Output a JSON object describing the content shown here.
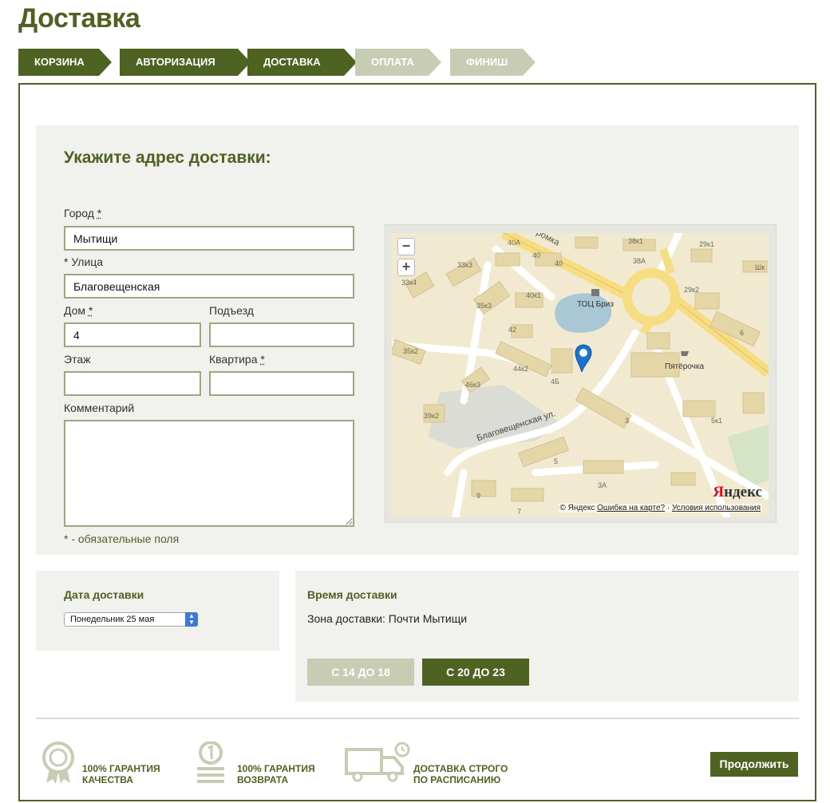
{
  "page": {
    "title": "Доставка"
  },
  "steps": [
    {
      "label": "Корзина",
      "state": "done"
    },
    {
      "label": "Авторизация",
      "state": "done"
    },
    {
      "label": "Доставка",
      "state": "active"
    },
    {
      "label": "Оплата",
      "state": "pending"
    },
    {
      "label": "Финиш",
      "state": "pending"
    }
  ],
  "address": {
    "title": "Укажите адрес доставки:",
    "city_label": "Город",
    "city_value": "Мытищи",
    "street_label": "Улица",
    "street_value": "Благовещенская",
    "house_label": "Дом",
    "house_value": "4",
    "entrance_label": "Подъезд",
    "entrance_value": "",
    "floor_label": "Этаж",
    "floor_value": "",
    "apartment_label": "Квартира",
    "apartment_value": "",
    "comment_label": "Комментарий",
    "comment_value": "",
    "required_star": "*",
    "required_note": "* - обязательные поля"
  },
  "map": {
    "copyright": "© Яндекс",
    "error_link": "Ошибка на карте?",
    "separator": "·",
    "terms_link": "Условия использования",
    "logo_first": "Я",
    "logo_rest": "ндекс",
    "zoom_out": "−",
    "zoom_in": "+",
    "street_name": "Благовещенская ул.",
    "road_name": "ромка",
    "poi_mall": "ТОЦ Бриз",
    "poi_shop": "Пятёрочка",
    "house_numbers": [
      "40А",
      "40",
      "40",
      "38к1",
      "38А",
      "29к1",
      "Шк",
      "33к3",
      "33к4",
      "35к3",
      "40к1",
      "42",
      "29к2",
      "6",
      "35к2",
      "44к2",
      "4Б",
      "46к3",
      "39к2",
      "3",
      "5к1",
      "5",
      "3А",
      "9",
      "7"
    ]
  },
  "delivery_date": {
    "title": "Дата доставки",
    "selected": "Понедельник 25 мая"
  },
  "delivery_time": {
    "title": "Время доставки",
    "zone_text": "Зона доставки: Почти Мытищи",
    "slots": [
      {
        "label": "С 14 ДО 18",
        "selected": false
      },
      {
        "label": "С 20 ДО 23",
        "selected": true
      }
    ]
  },
  "features": [
    {
      "line1": "100% гарантия",
      "line2": "качества",
      "icon": "quality-medal-icon"
    },
    {
      "line1": "100% гарантия",
      "line2": "возврата",
      "icon": "coin-stack-icon"
    },
    {
      "line1": "Доставка строго",
      "line2": "по расписанию",
      "icon": "delivery-truck-icon"
    }
  ],
  "actions": {
    "continue_label": "Продолжить"
  },
  "colors": {
    "brand": "#4e6222",
    "inactive": "#c7ccb4",
    "panel": "#f1f1ed"
  }
}
